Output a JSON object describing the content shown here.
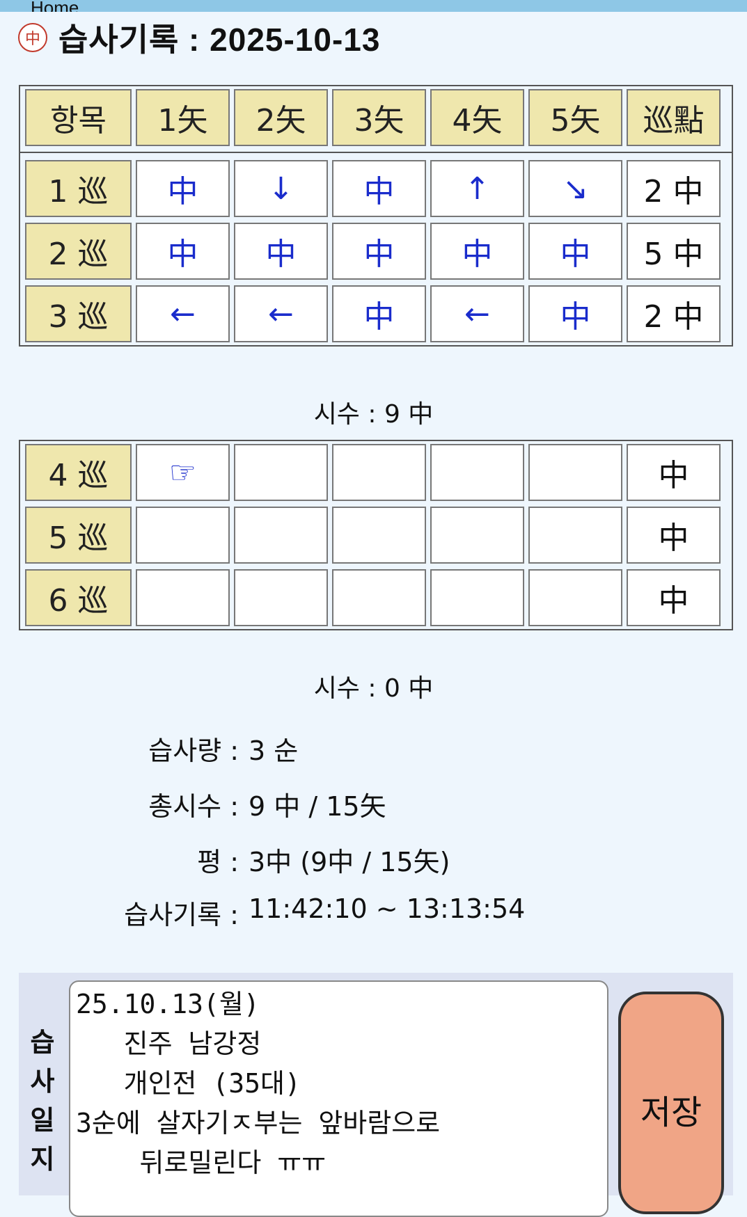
{
  "topbar": {
    "home_label": "Home"
  },
  "header": {
    "logo": "中",
    "title": "습사기록 : 2025-10-13"
  },
  "columns": [
    "항목",
    "1矢",
    "2矢",
    "3矢",
    "4矢",
    "5矢",
    "巡點"
  ],
  "set1": {
    "rows": [
      {
        "label": "1 巡",
        "shots": [
          "中",
          "↓",
          "中",
          "↑",
          "↘"
        ],
        "score": "2 中"
      },
      {
        "label": "2 巡",
        "shots": [
          "中",
          "中",
          "中",
          "中",
          "中"
        ],
        "score": "5 中"
      },
      {
        "label": "3 巡",
        "shots": [
          "←",
          "←",
          "中",
          "←",
          "中"
        ],
        "score": "2 中"
      }
    ],
    "summary": "시수 : 9 中"
  },
  "set2": {
    "rows": [
      {
        "label": "4 巡",
        "shots": [
          "☞",
          "",
          "",
          "",
          ""
        ],
        "score": "中"
      },
      {
        "label": "5 巡",
        "shots": [
          "",
          "",
          "",
          "",
          ""
        ],
        "score": "中"
      },
      {
        "label": "6 巡",
        "shots": [
          "",
          "",
          "",
          "",
          ""
        ],
        "score": "中"
      }
    ],
    "summary": "시수 : 0 中"
  },
  "stats": [
    {
      "key": "습사량 :",
      "value": "3 순"
    },
    {
      "key": "총시수 :",
      "value": "9 中 / 15矢"
    },
    {
      "key": "평 :",
      "value": "3中 (9中 / 15矢)"
    },
    {
      "key": "습사기록 :",
      "value": "11:42:10 ~ 13:13:54"
    }
  ],
  "journal": {
    "side_label": [
      "습",
      "사",
      "일",
      "지"
    ],
    "text": "25.10.13(월)\n   진주 남강정\n   개인전 (35대)\n3순에 살자기ㅈ부는 앞바람으로\n    뒤로밀린다 ㅠㅠ",
    "save_label": "저장"
  }
}
